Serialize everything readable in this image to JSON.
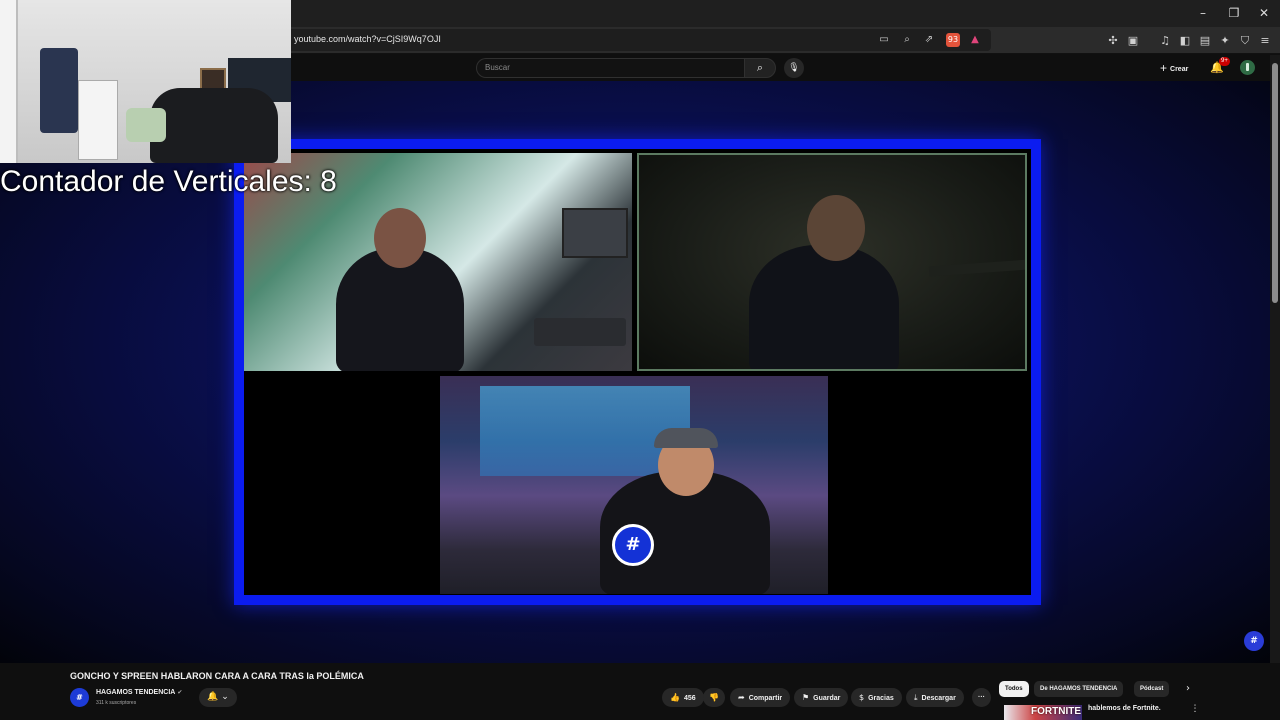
{
  "browser": {
    "url": "youtube.com/watch?v=CjSI9Wq7OJI",
    "brave_badge": "93"
  },
  "masthead": {
    "search_placeholder": "Buscar",
    "create_label": "Crear",
    "notifications_badge": "9+"
  },
  "overlay": {
    "counter_label": "Contador de Verticales: 8"
  },
  "video": {
    "title": "GONCHO Y SPREEN HABLARON CARA A CARA TRAS la POLÉMICA",
    "channel_name": "HAGAMOS TENDENCIA",
    "subscribers": "311 k suscriptores",
    "like_count": "456",
    "share_label": "Compartir",
    "save_label": "Guardar",
    "thanks_label": "Gracias",
    "download_label": "Descargar"
  },
  "recommendations": {
    "chips": [
      "Todos",
      "De HAGAMOS TENDENCIA",
      "Pódcast"
    ],
    "active_chip": "Todos",
    "first_item_title": "hablemos de Fortnite.",
    "first_item_thumb_text": "FORTNITE"
  },
  "icons": {
    "window_controls": [
      "minimize-icon",
      "restore-icon",
      "close-icon"
    ],
    "toolbar": [
      "extensions-icon",
      "media-icon",
      "music-icon",
      "sidebar-icon",
      "wallet-icon",
      "leo-ai-icon",
      "vpn-shield-icon",
      "menu-icon"
    ],
    "address_bar": [
      "cast-icon",
      "zoom-icon",
      "share-icon",
      "brave-shields-icon",
      "brave-rewards-icon"
    ]
  },
  "colors": {
    "frame_border": "#0b1cf0",
    "channel_brand": "#1d3bd7",
    "notification_badge": "#cc0000"
  }
}
